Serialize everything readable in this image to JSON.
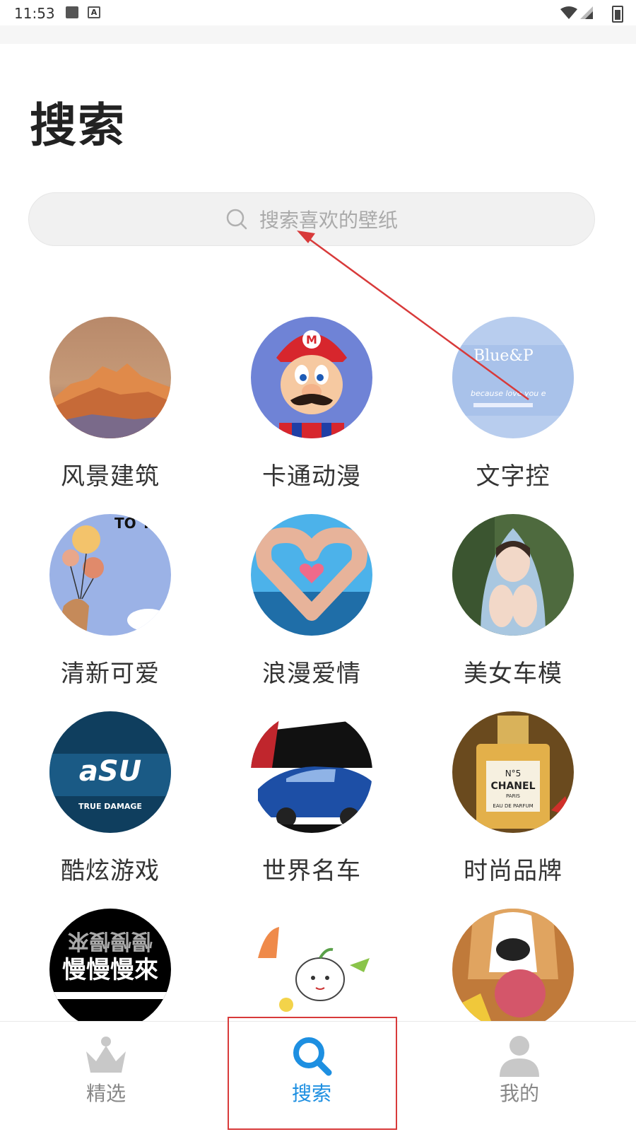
{
  "status_bar": {
    "time": "11:53"
  },
  "page": {
    "title": "搜索"
  },
  "search": {
    "placeholder": "搜索喜欢的壁纸"
  },
  "categories": [
    {
      "label": "风景建筑",
      "image": "mountain-sunset"
    },
    {
      "label": "卡通动漫",
      "image": "mario"
    },
    {
      "label": "文字控",
      "image": "blue-text-card"
    },
    {
      "label": "清新可爱",
      "image": "balloons-to-you"
    },
    {
      "label": "浪漫爱情",
      "image": "heart-hands-ocean"
    },
    {
      "label": "美女车模",
      "image": "girl-hoodie"
    },
    {
      "label": "酷炫游戏",
      "image": "true-damage-logo"
    },
    {
      "label": "世界名车",
      "image": "blue-car"
    },
    {
      "label": "时尚品牌",
      "image": "perfume-bottle"
    },
    {
      "label": "慢慢慢來",
      "image": "black-text-art"
    },
    {
      "label": "",
      "image": "cute-cartoon"
    },
    {
      "label": "",
      "image": "corgi-flower"
    }
  ],
  "card_texts": {
    "to_you": "TO YOU",
    "blue": "Blue&P",
    "because": "because love you e",
    "true_damage": "TRUE DAMAGE",
    "chanel": "CHANEL",
    "no5": "N°5",
    "paris": "PARIS",
    "eau": "EAU DE PARFUM",
    "slow": "慢慢慢來"
  },
  "bottom_nav": {
    "items": [
      {
        "label": "精选",
        "icon": "crown-icon",
        "active": false
      },
      {
        "label": "搜索",
        "icon": "search-icon",
        "active": true
      },
      {
        "label": "我的",
        "icon": "user-icon",
        "active": false
      }
    ]
  },
  "colors": {
    "accent": "#1d8fe1",
    "annotation": "#d83a3a",
    "inactive": "#888888"
  }
}
